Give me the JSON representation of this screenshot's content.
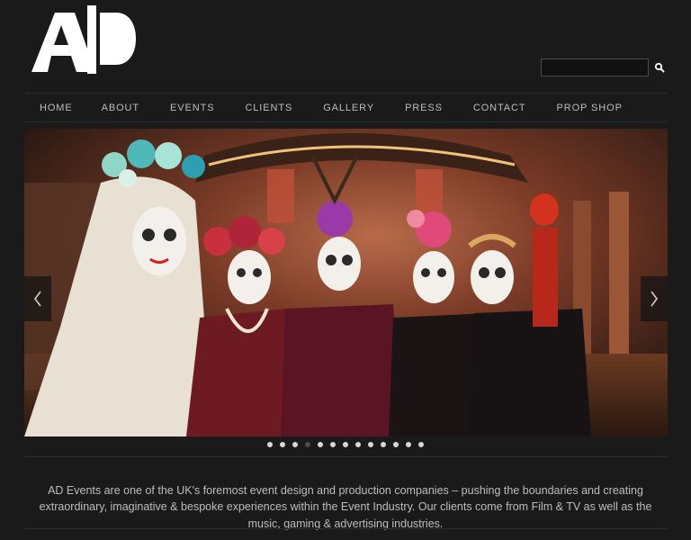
{
  "brand": {
    "logo_text": "AD"
  },
  "search": {
    "placeholder": "",
    "value": ""
  },
  "nav": {
    "items": [
      {
        "label": "HOME"
      },
      {
        "label": "ABOUT"
      },
      {
        "label": "EVENTS"
      },
      {
        "label": "CLIENTS"
      },
      {
        "label": "GALLERY"
      },
      {
        "label": "PRESS"
      },
      {
        "label": "CONTACT"
      },
      {
        "label": "PROP SHOP"
      }
    ]
  },
  "slider": {
    "image_subject": "Five models in Day of the Dead sugar-skull makeup with floral headdresses",
    "dot_count": 13,
    "active_index": 3
  },
  "about": {
    "text": "AD Events are one of the UK's foremost event design and production companies – pushing the boundaries and creating extraordinary, imaginative & bespoke experiences within the Event Industry. Our clients come from Film & TV as well as the music, gaming & advertising industries."
  },
  "colors": {
    "background": "#1a1a1a",
    "text": "#bdbdbd",
    "logo": "#ffffff"
  }
}
